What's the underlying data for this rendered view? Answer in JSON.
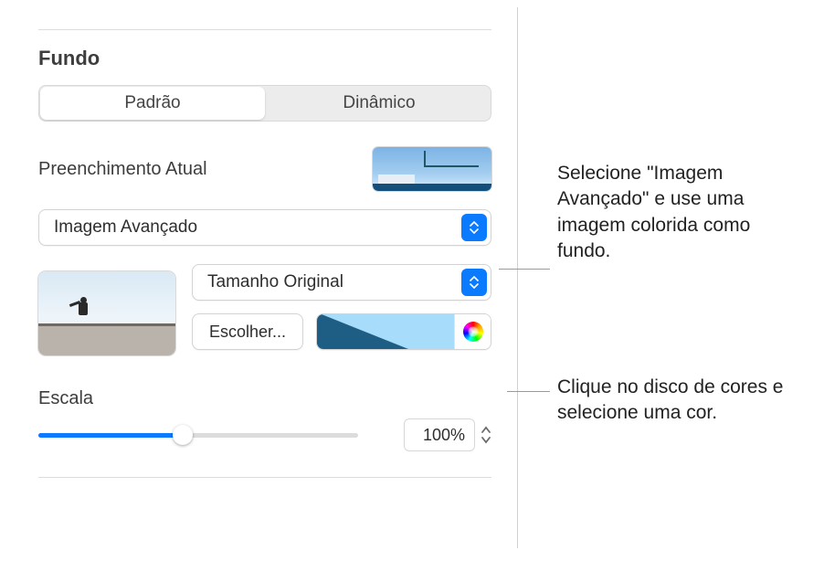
{
  "section": {
    "title": "Fundo"
  },
  "tabs": {
    "standard": "Padrão",
    "dynamic": "Dinâmico"
  },
  "fill": {
    "label": "Preenchimento Atual",
    "type_selected": "Imagem Avançado",
    "scale_mode": "Tamanho Original",
    "choose_button": "Escolher...",
    "tint_color": "#a8dcfb",
    "tint_color_dark": "#1e5d84"
  },
  "scale": {
    "label": "Escala",
    "value_percent": 100,
    "value_display": "100%",
    "slider_position_pct": 45
  },
  "callouts": {
    "c1": "Selecione \"Imagem Avançado\" e use uma imagem colorida como fundo.",
    "c2": "Clique no disco de cores e selecione uma cor."
  },
  "icons": {
    "updown": "updown-icon",
    "color_disc": "color-disc-icon",
    "stepper_up": "stepper-up-icon",
    "stepper_down": "stepper-down-icon"
  }
}
